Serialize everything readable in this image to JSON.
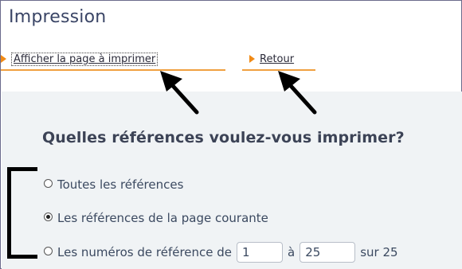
{
  "page": {
    "title": "Impression"
  },
  "nav": {
    "print_link": "Afficher la page à imprimer",
    "back_link": "Retour"
  },
  "section": {
    "question": "Quelles références voulez-vous imprimer?",
    "options": [
      {
        "label": "Toutes les références",
        "checked": false
      },
      {
        "label": "Les références de la page courante",
        "checked": true
      },
      {
        "label": "Les numéros de référence de",
        "checked": false
      }
    ],
    "range": {
      "from": "1",
      "separator": "à",
      "to": "25",
      "total_label": "sur 25"
    }
  },
  "colors": {
    "accent": "#f08a16",
    "title": "#3a4566",
    "panel_bg": "#f0f3f5"
  }
}
